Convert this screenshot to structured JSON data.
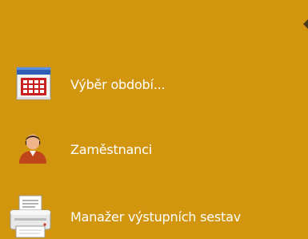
{
  "panel": {
    "background": "#d1960e",
    "text_color": "#ffffff"
  },
  "menu": {
    "items": [
      {
        "label": "Výběr období...",
        "icon": "calendar-icon"
      },
      {
        "label": "Zaměstnanci",
        "icon": "employee-person-icon"
      },
      {
        "label": "Manažer výstupních sestav",
        "icon": "printer-icon"
      }
    ]
  },
  "corner": {
    "icon": "collapse-arrow-icon"
  }
}
